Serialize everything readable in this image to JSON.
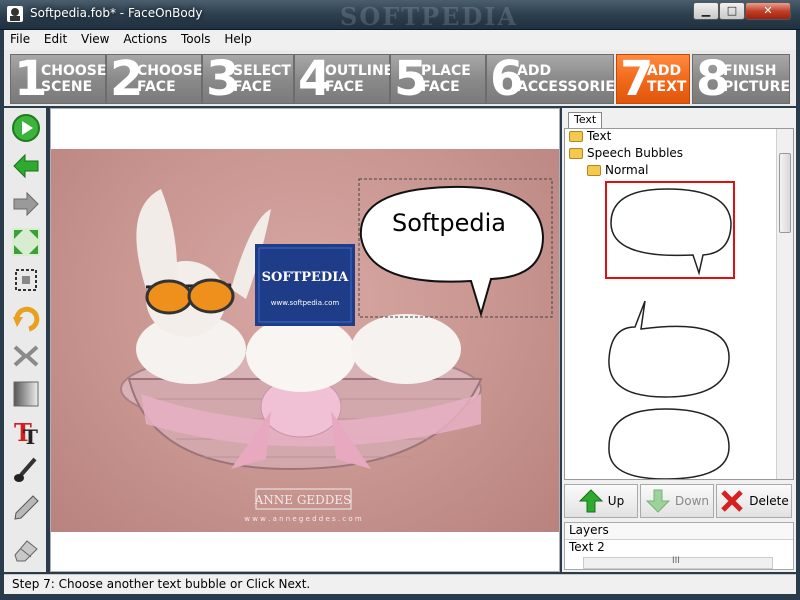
{
  "window": {
    "title": "Softpedia.fob* - FaceOnBody",
    "watermark": "SOFTPEDIA",
    "min_label": "▁",
    "max_label": "□",
    "close_label": "✕"
  },
  "menu": [
    "File",
    "Edit",
    "View",
    "Actions",
    "Tools",
    "Help"
  ],
  "steps": [
    {
      "num": "1",
      "label": "CHOOSE\nSCENE"
    },
    {
      "num": "2",
      "label": "CHOOSE\nFACE"
    },
    {
      "num": "3",
      "label": "SELECT\nFACE"
    },
    {
      "num": "4",
      "label": "OUTLINE\nFACE"
    },
    {
      "num": "5",
      "label": "PLACE\nFACE"
    },
    {
      "num": "6",
      "label": "ADD\nACCESSORIES"
    },
    {
      "num": "7",
      "label": "ADD\nTEXT"
    },
    {
      "num": "8",
      "label": "FINISH\nPICTURE"
    }
  ],
  "tools": [
    "play-icon",
    "back-arrow-icon",
    "forward-arrow-icon",
    "expand-icon",
    "crop-select-icon",
    "rotate-icon",
    "flip-icon",
    "gradient-icon",
    "text-tool-icon",
    "brush-icon",
    "pencil-icon",
    "eraser-icon"
  ],
  "canvas": {
    "bubble_text": "Softpedia",
    "logo_title": "SOFTPEDIA",
    "logo_url": "www.softpedia.com",
    "photo_brand": "ANNE GEDDES",
    "photo_url": "w w w . a n n e g e d d e s . c o m"
  },
  "panel": {
    "tab_label": "Text",
    "tree": {
      "root": "Text",
      "child": "Speech Bubbles",
      "grandchild": "Normal"
    },
    "buttons": {
      "up": "Up",
      "down": "Down",
      "delete": "Delete"
    },
    "layers": {
      "header": "Layers",
      "items": [
        "Text 2"
      ]
    },
    "scroll_label": "III"
  },
  "status": {
    "text": "Step 7: Choose another text bubble or Click Next."
  },
  "colors": {
    "active_step": "#f26a1c",
    "inactive_step": "#8a8a8a",
    "selection": "#e01010"
  }
}
